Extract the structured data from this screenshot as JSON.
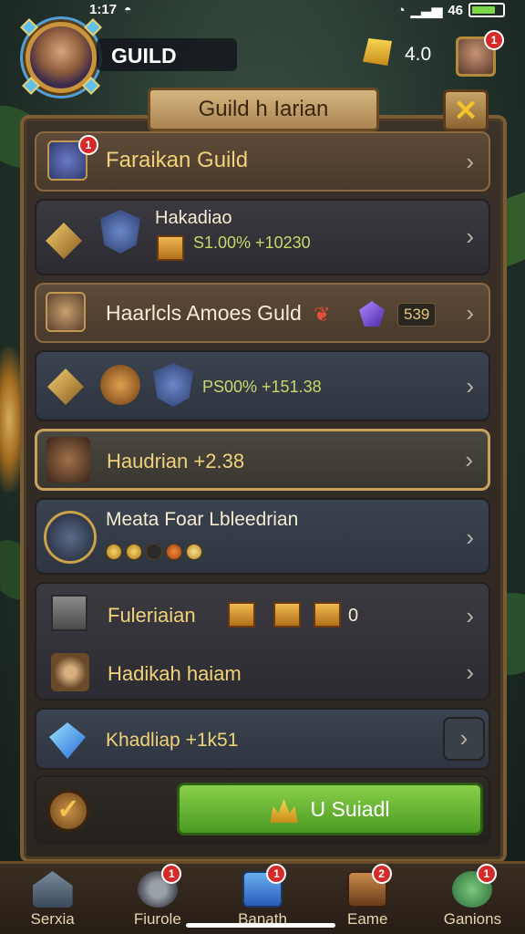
{
  "status": {
    "time": "1:1",
    "time_suffix": "7",
    "signal": "4",
    "signal_suffix": "6"
  },
  "header": {
    "guild_label": "GUILD",
    "gold_value": "4.0",
    "profile_badge": "1"
  },
  "panel": {
    "title": "Guild h Iarian",
    "close": "✕"
  },
  "rows": [
    {
      "label": "Faraikan Guild",
      "badge": "1"
    },
    {
      "label": "Hakadiao",
      "detail": "S1.00% +10230"
    },
    {
      "label": "Haarlcls Amoes Guld",
      "value": "539"
    },
    {
      "detail": "PS00% +151.38"
    },
    {
      "label": "Haudrian +2.38"
    },
    {
      "label": "Meata Foar Lbleedrian"
    },
    {
      "label": "Fuleriaian",
      "value": "0"
    },
    {
      "label": "Hadikah haiam"
    },
    {
      "label": "Khadliap +1k51"
    }
  ],
  "action": {
    "label": "U Suiadl"
  },
  "nav": [
    {
      "label": "Serxia",
      "badge": ""
    },
    {
      "label": "Fiurole",
      "badge": "1"
    },
    {
      "label": "Banath",
      "badge": "1"
    },
    {
      "label": "Eame",
      "badge": "2"
    },
    {
      "label": "Ganions",
      "badge": "1"
    }
  ]
}
